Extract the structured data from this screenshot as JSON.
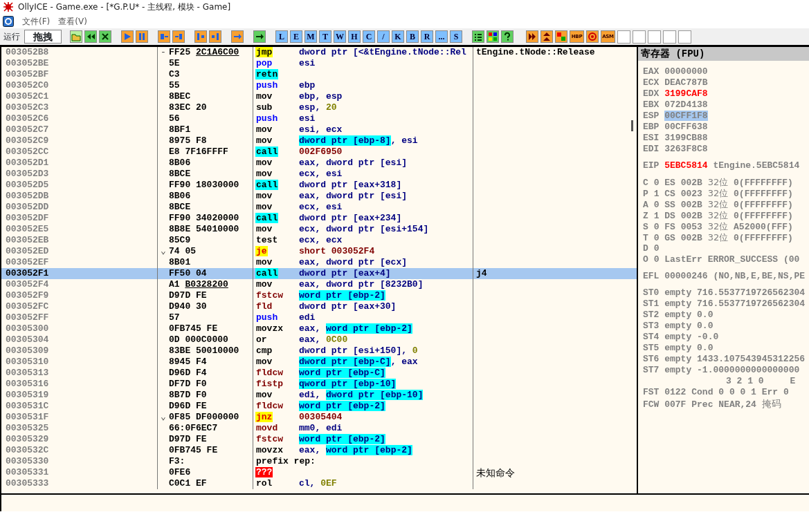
{
  "window": {
    "title": "OllyICE - Game.exe - [*G.P.U* -  主线程, 模块 - Game]"
  },
  "menu": [
    {
      "label": "文件(F)"
    },
    {
      "label": "查看(V)"
    }
  ],
  "toolbar": {
    "status": "运行",
    "mode": "拖拽",
    "window_buttons": [
      "L",
      "E",
      "M",
      "T",
      "W",
      "H",
      "C",
      "/",
      "K",
      "B",
      "R",
      "...",
      "S"
    ],
    "plugin_buttons": [
      "HBP",
      "ASM"
    ]
  },
  "disasm": {
    "rows": [
      {
        "address": "003052B8",
        "marker": "-",
        "hex": "FF25 ",
        "reloc": "2C1A6C00",
        "mnemonic": "jmp",
        "kind": "jump",
        "ops": [
          {
            "t": "dword ptr [<&tEngine.tNode::Rel",
            "kind": "plain"
          }
        ],
        "comment": "tEngine.tNode::Release",
        "selected": false
      },
      {
        "address": "003052BE",
        "hex": "5E",
        "mnemonic": "pop",
        "kind": "stack",
        "ops": [
          {
            "t": "esi",
            "kind": "plain"
          }
        ],
        "selected": false
      },
      {
        "address": "003052BF",
        "hex": "C3",
        "mnemonic": "retn",
        "kind": "call",
        "selected": false
      },
      {
        "address": "003052C0",
        "hex": "55",
        "mnemonic": "push",
        "kind": "stack",
        "ops": [
          {
            "t": "ebp",
            "kind": "plain"
          }
        ],
        "selected": false
      },
      {
        "address": "003052C1",
        "hex": "8BEC",
        "mnemonic": "mov",
        "kind": "plain",
        "ops": [
          {
            "t": "ebp, esp",
            "kind": "plain"
          }
        ],
        "selected": false
      },
      {
        "address": "003052C3",
        "hex": "83EC 20",
        "mnemonic": "sub",
        "kind": "plain",
        "ops": [
          {
            "t": "esp, ",
            "kind": "plain"
          },
          {
            "t": "20",
            "kind": "imm"
          }
        ],
        "selected": false
      },
      {
        "address": "003052C6",
        "hex": "56",
        "mnemonic": "push",
        "kind": "stack",
        "ops": [
          {
            "t": "esi",
            "kind": "plain"
          }
        ],
        "selected": false
      },
      {
        "address": "003052C7",
        "hex": "8BF1",
        "mnemonic": "mov",
        "kind": "plain",
        "ops": [
          {
            "t": "esi, ecx",
            "kind": "plain"
          }
        ],
        "selected": false
      },
      {
        "address": "003052C9",
        "hex": "8975 F8",
        "mnemonic": "mov",
        "kind": "plain",
        "ops": [
          {
            "t": "dword ptr [ebp-8]",
            "kind": "frame"
          },
          {
            "t": ", esi",
            "kind": "plain"
          }
        ],
        "selected": false
      },
      {
        "address": "003052CC",
        "hex": "E8 7F16FFFF",
        "mnemonic": "call",
        "kind": "call",
        "ops": [
          {
            "t": "002F6950",
            "kind": "target"
          }
        ],
        "selected": false
      },
      {
        "address": "003052D1",
        "hex": "8B06",
        "mnemonic": "mov",
        "kind": "plain",
        "ops": [
          {
            "t": "eax, dword ptr [esi]",
            "kind": "plain"
          }
        ],
        "selected": false
      },
      {
        "address": "003052D3",
        "hex": "8BCE",
        "mnemonic": "mov",
        "kind": "plain",
        "ops": [
          {
            "t": "ecx, esi",
            "kind": "plain"
          }
        ],
        "selected": false
      },
      {
        "address": "003052D5",
        "hex": "FF90 18030000",
        "mnemonic": "call",
        "kind": "call",
        "ops": [
          {
            "t": "dword ptr [eax+318]",
            "kind": "plain"
          }
        ],
        "selected": false
      },
      {
        "address": "003052DB",
        "hex": "8B06",
        "mnemonic": "mov",
        "kind": "plain",
        "ops": [
          {
            "t": "eax, dword ptr [esi]",
            "kind": "plain"
          }
        ],
        "selected": false
      },
      {
        "address": "003052DD",
        "hex": "8BCE",
        "mnemonic": "mov",
        "kind": "plain",
        "ops": [
          {
            "t": "ecx, esi",
            "kind": "plain"
          }
        ],
        "selected": false
      },
      {
        "address": "003052DF",
        "hex": "FF90 34020000",
        "mnemonic": "call",
        "kind": "call",
        "ops": [
          {
            "t": "dword ptr [eax+234]",
            "kind": "plain"
          }
        ],
        "selected": false
      },
      {
        "address": "003052E5",
        "hex": "8B8E 54010000",
        "mnemonic": "mov",
        "kind": "plain",
        "ops": [
          {
            "t": "ecx, dword ptr [esi+154]",
            "kind": "plain"
          }
        ],
        "selected": false
      },
      {
        "address": "003052EB",
        "hex": "85C9",
        "mnemonic": "test",
        "kind": "plain",
        "ops": [
          {
            "t": "ecx, ecx",
            "kind": "plain"
          }
        ],
        "selected": false
      },
      {
        "address": "003052ED",
        "marker": "⌄",
        "hex": "74 05",
        "mnemonic": "je",
        "kind": "branch",
        "ops": [
          {
            "t": "short 003052F4",
            "kind": "target"
          }
        ],
        "selected": false
      },
      {
        "address": "003052EF",
        "hex": "8B01",
        "mnemonic": "mov",
        "kind": "plain",
        "ops": [
          {
            "t": "eax, dword ptr [ecx]",
            "kind": "plain"
          }
        ],
        "selected": false
      },
      {
        "address": "003052F1",
        "hex": "FF50 04",
        "mnemonic": "call",
        "kind": "call",
        "ops": [
          {
            "t": "dword ptr [eax+4]",
            "kind": "plain"
          }
        ],
        "comment": "j4",
        "selected": true
      },
      {
        "address": "003052F4",
        "hex": "A1 ",
        "reloc": "B0328200",
        "mnemonic": "mov",
        "kind": "plain",
        "ops": [
          {
            "t": "eax, dword ptr [8232B0]",
            "kind": "plain"
          }
        ],
        "selected": false
      },
      {
        "address": "003052F9",
        "hex": "D97D FE",
        "mnemonic": "fstcw",
        "kind": "fpu",
        "ops": [
          {
            "t": "word ptr [ebp-2]",
            "kind": "frame"
          }
        ],
        "selected": false
      },
      {
        "address": "003052FC",
        "hex": "D940 30",
        "mnemonic": "fld",
        "kind": "fpu",
        "ops": [
          {
            "t": "dword ptr [eax+30]",
            "kind": "plain"
          }
        ],
        "selected": false
      },
      {
        "address": "003052FF",
        "hex": "57",
        "mnemonic": "push",
        "kind": "stack",
        "ops": [
          {
            "t": "edi",
            "kind": "plain"
          }
        ],
        "selected": false
      },
      {
        "address": "00305300",
        "hex": "0FB745 FE",
        "mnemonic": "movzx",
        "kind": "plain",
        "ops": [
          {
            "t": "eax, ",
            "kind": "plain"
          },
          {
            "t": "word ptr [ebp-2]",
            "kind": "frame"
          }
        ],
        "selected": false
      },
      {
        "address": "00305304",
        "hex": "0D 000C0000",
        "mnemonic": "or",
        "kind": "plain",
        "ops": [
          {
            "t": "eax, ",
            "kind": "plain"
          },
          {
            "t": "0C00",
            "kind": "imm"
          }
        ],
        "selected": false
      },
      {
        "address": "00305309",
        "hex": "83BE 50010000",
        "mnemonic": "cmp",
        "kind": "plain",
        "ops": [
          {
            "t": "dword ptr [esi+150], ",
            "kind": "plain"
          },
          {
            "t": "0",
            "kind": "imm"
          }
        ],
        "selected": false
      },
      {
        "address": "00305310",
        "hex": "8945 F4",
        "mnemonic": "mov",
        "kind": "plain",
        "ops": [
          {
            "t": "dword ptr [ebp-C]",
            "kind": "frame"
          },
          {
            "t": ", eax",
            "kind": "plain"
          }
        ],
        "selected": false
      },
      {
        "address": "00305313",
        "hex": "D96D F4",
        "mnemonic": "fldcw",
        "kind": "fpu",
        "ops": [
          {
            "t": "word ptr [ebp-C]",
            "kind": "frame"
          }
        ],
        "selected": false
      },
      {
        "address": "00305316",
        "hex": "DF7D F0",
        "mnemonic": "fistp",
        "kind": "fpu",
        "ops": [
          {
            "t": "qword ptr [ebp-10]",
            "kind": "frame"
          }
        ],
        "selected": false
      },
      {
        "address": "00305319",
        "hex": "8B7D F0",
        "mnemonic": "mov",
        "kind": "plain",
        "ops": [
          {
            "t": "edi, ",
            "kind": "plain"
          },
          {
            "t": "dword ptr [ebp-10]",
            "kind": "frame"
          }
        ],
        "selected": false
      },
      {
        "address": "0030531C",
        "hex": "D96D FE",
        "mnemonic": "fldcw",
        "kind": "fpu",
        "ops": [
          {
            "t": "word ptr [ebp-2]",
            "kind": "frame"
          }
        ],
        "selected": false
      },
      {
        "address": "0030531F",
        "marker": "⌄",
        "hex": "0F85 DF000000",
        "mnemonic": "jnz",
        "kind": "branch",
        "ops": [
          {
            "t": "00305404",
            "kind": "target"
          }
        ],
        "selected": false
      },
      {
        "address": "00305325",
        "hex": "66:0F6EC7",
        "mnemonic": "movd",
        "kind": "fpu",
        "ops": [
          {
            "t": "mm0, edi",
            "kind": "plain"
          }
        ],
        "selected": false
      },
      {
        "address": "00305329",
        "hex": "D97D FE",
        "mnemonic": "fstcw",
        "kind": "fpu",
        "ops": [
          {
            "t": "word ptr [ebp-2]",
            "kind": "frame"
          }
        ],
        "selected": false
      },
      {
        "address": "0030532C",
        "hex": "0FB745 FE",
        "mnemonic": "movzx",
        "kind": "plain",
        "ops": [
          {
            "t": "eax, ",
            "kind": "plain"
          },
          {
            "t": "word ptr [ebp-2]",
            "kind": "frame"
          }
        ],
        "selected": false
      },
      {
        "address": "00305330",
        "hex": "F3:",
        "mnemonic": "prefix rep:",
        "kind": "plain",
        "selected": false
      },
      {
        "address": "00305331",
        "hex": "0FE6",
        "mnemonic": "???",
        "kind": "unknown",
        "comment": "未知命令",
        "selected": false
      },
      {
        "address": "00305333",
        "hex": "C0C1 EF",
        "mnemonic": "rol",
        "kind": "plain",
        "ops": [
          {
            "t": "cl, ",
            "kind": "plain"
          },
          {
            "t": "0EF",
            "kind": "imm"
          }
        ],
        "selected": false
      }
    ]
  },
  "registers": {
    "title": "寄存器 (FPU)",
    "gpr": [
      {
        "name": "EAX",
        "value": "00000000",
        "changed": false,
        "selected": false
      },
      {
        "name": "ECX",
        "value": "DEAC787B",
        "changed": false,
        "selected": false
      },
      {
        "name": "EDX",
        "value": "3199CAF8",
        "changed": true,
        "selected": false
      },
      {
        "name": "EBX",
        "value": "072D4138",
        "changed": false,
        "selected": false
      },
      {
        "name": "ESP",
        "value": "00CFF1F8",
        "changed": false,
        "selected": true
      },
      {
        "name": "EBP",
        "value": "00CFF638",
        "changed": false,
        "selected": false
      },
      {
        "name": "ESI",
        "value": "3199CB88",
        "changed": false,
        "selected": false
      },
      {
        "name": "EDI",
        "value": "3263F8C8",
        "changed": false,
        "selected": false
      }
    ],
    "eip": {
      "name": "EIP",
      "value": "5EBC5814",
      "changed": true,
      "comment": "tEngine.5EBC5814"
    },
    "flags": [
      {
        "flag": "C",
        "value": "0",
        "seg": "ES",
        "sel": "002B",
        "bits": "32位",
        "base": "0(FFFFFFFF)"
      },
      {
        "flag": "P",
        "value": "1",
        "seg": "CS",
        "sel": "0023",
        "bits": "32位",
        "base": "0(FFFFFFFF)"
      },
      {
        "flag": "A",
        "value": "0",
        "seg": "SS",
        "sel": "002B",
        "bits": "32位",
        "base": "0(FFFFFFFF)"
      },
      {
        "flag": "Z",
        "value": "1",
        "seg": "DS",
        "sel": "002B",
        "bits": "32位",
        "base": "0(FFFFFFFF)"
      },
      {
        "flag": "S",
        "value": "0",
        "seg": "FS",
        "sel": "0053",
        "bits": "32位",
        "base": "A52000(FFF)"
      },
      {
        "flag": "T",
        "value": "0",
        "seg": "GS",
        "sel": "002B",
        "bits": "32位",
        "base": "0(FFFFFFFF)"
      },
      {
        "flag": "D",
        "value": "0"
      },
      {
        "flag": "O",
        "value": "0",
        "lasterr": "LastErr ERROR_SUCCESS (00"
      }
    ],
    "efl": {
      "name": "EFL",
      "value": "00000246",
      "decoded": "(NO,NB,E,BE,NS,PE"
    },
    "st": [
      {
        "name": "ST0",
        "tag": "empty",
        "value": "716.5537719726562304"
      },
      {
        "name": "ST1",
        "tag": "empty",
        "value": "716.5537719726562304"
      },
      {
        "name": "ST2",
        "tag": "empty",
        "value": "0.0"
      },
      {
        "name": "ST3",
        "tag": "empty",
        "value": "0.0"
      },
      {
        "name": "ST4",
        "tag": "empty",
        "value": "-0.0"
      },
      {
        "name": "ST5",
        "tag": "empty",
        "value": "0.0"
      },
      {
        "name": "ST6",
        "tag": "empty",
        "value": "1433.107543945312256"
      },
      {
        "name": "ST7",
        "tag": "empty",
        "value": "-1.0000000000000000"
      }
    ],
    "fpu_header": {
      "bits": "3 2 1 0",
      "e": "E"
    },
    "fst": {
      "name": "FST",
      "value": "0122",
      "cond_label": "Cond",
      "cond": "0 0 0 1",
      "err_label": "Err",
      "err": "0"
    },
    "fcw": {
      "name": "FCW",
      "value": "007F",
      "prec_label": "Prec",
      "prec": "NEAR,24",
      "mask_label": "掩码"
    }
  }
}
